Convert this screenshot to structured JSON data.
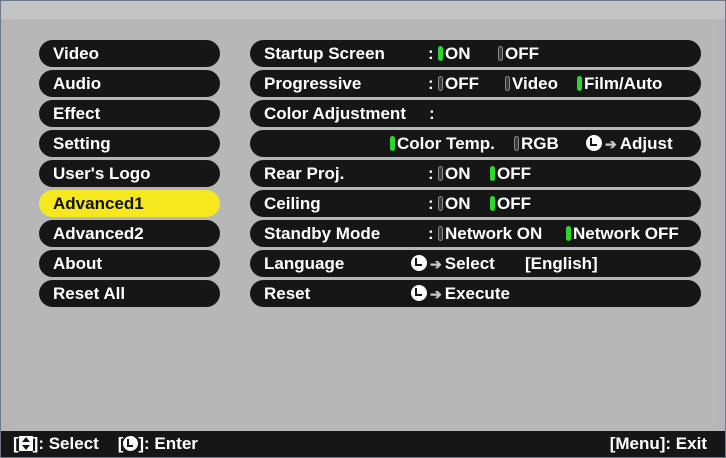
{
  "menu": {
    "items": [
      {
        "label": "Video"
      },
      {
        "label": "Audio"
      },
      {
        "label": "Effect"
      },
      {
        "label": "Setting"
      },
      {
        "label": "User's Logo"
      },
      {
        "label": "Advanced1",
        "active": true
      },
      {
        "label": "Advanced2"
      },
      {
        "label": "About"
      },
      {
        "label": "Reset All"
      }
    ]
  },
  "settings": {
    "startup_screen": {
      "label": "Startup Screen",
      "colon": ":",
      "options": [
        "ON",
        "OFF"
      ],
      "selected": "ON"
    },
    "progressive": {
      "label": "Progressive",
      "colon": ":",
      "options": [
        "OFF",
        "Video",
        "Film/Auto"
      ],
      "selected": "Film/Auto"
    },
    "color_adjustment": {
      "label": "Color Adjustment",
      "colon": ":",
      "options": [
        "Color Temp.",
        "RGB"
      ],
      "selected": "Color Temp.",
      "action": "Adjust"
    },
    "rear_proj": {
      "label": "Rear Proj.",
      "colon": ":",
      "options": [
        "ON",
        "OFF"
      ],
      "selected": "OFF"
    },
    "ceiling": {
      "label": "Ceiling",
      "colon": ":",
      "options": [
        "ON",
        "OFF"
      ],
      "selected": "OFF"
    },
    "standby_mode": {
      "label": "Standby Mode",
      "colon": ":",
      "options": [
        "Network ON",
        "Network OFF"
      ],
      "selected": "Network OFF"
    },
    "language": {
      "label": "Language",
      "action": "Select",
      "value": "[English]"
    },
    "reset": {
      "label": "Reset",
      "action": "Execute"
    }
  },
  "footer": {
    "select_bracket_open": "[",
    "select_label": "]: Select",
    "enter_bracket_open": "[",
    "enter_label": "]: Enter",
    "exit_label": "[Menu]: Exit"
  },
  "colors": {
    "pill": "#161616",
    "active_pill": "#f5e81f",
    "selected_dot": "#2bd72b",
    "background": "#b6b6b6"
  }
}
